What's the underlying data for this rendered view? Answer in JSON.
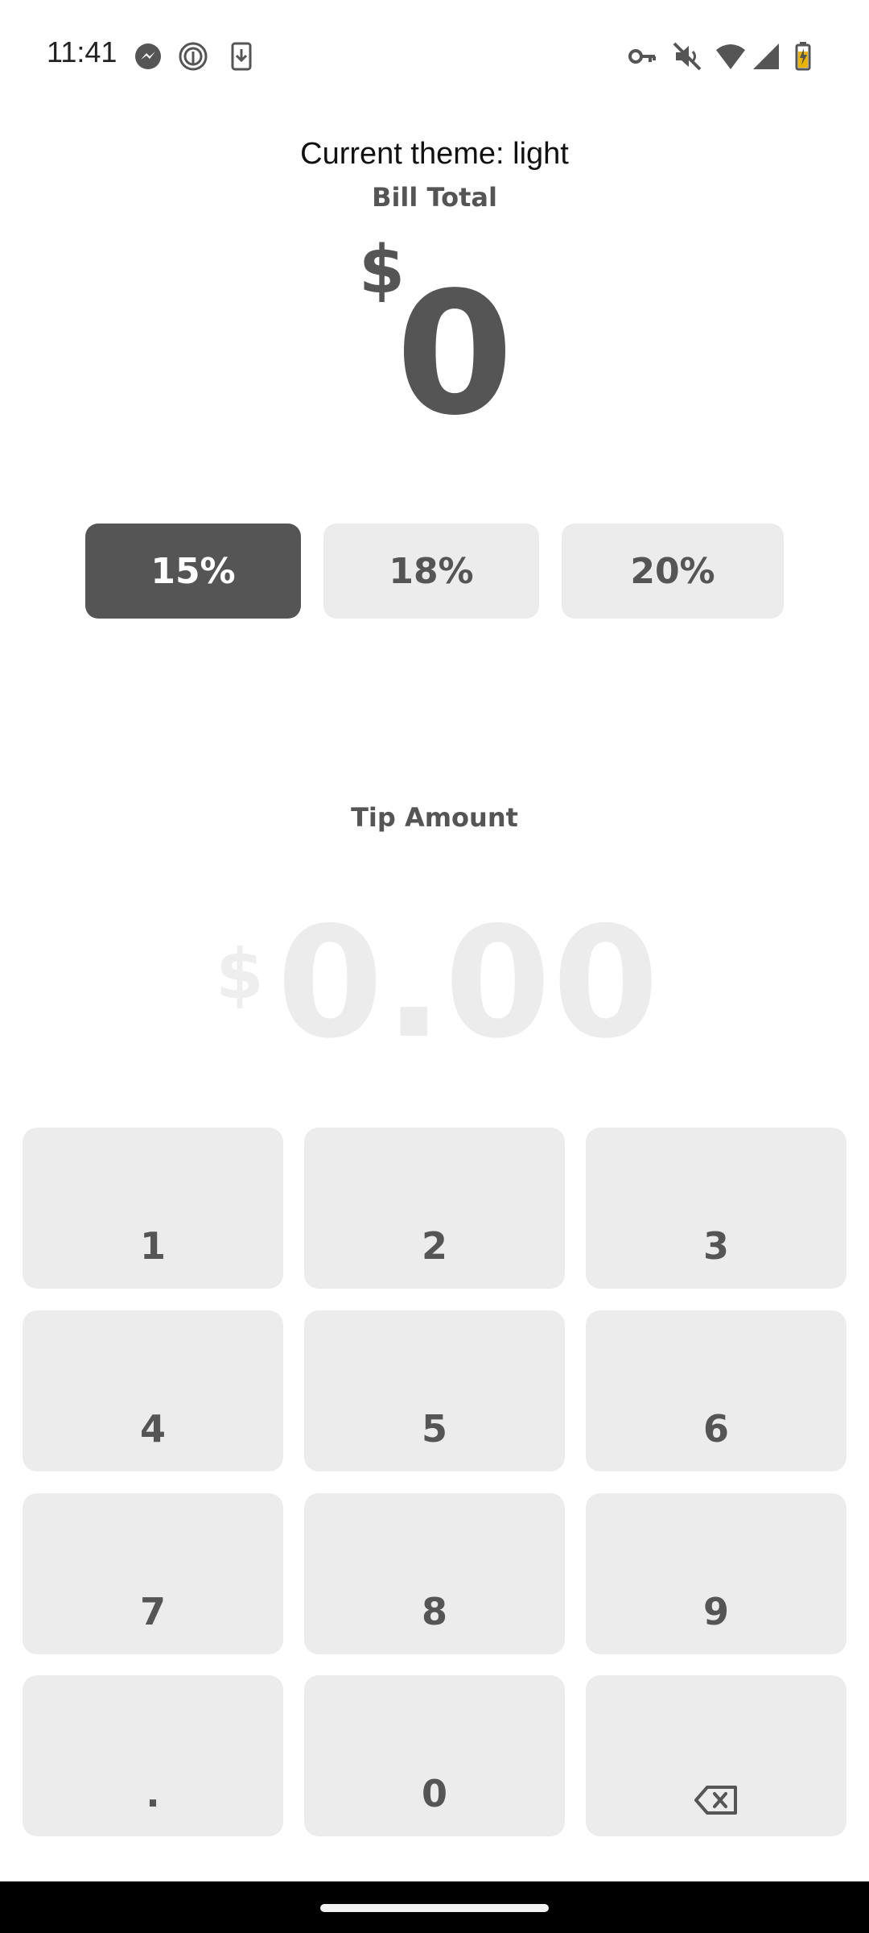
{
  "status_bar": {
    "time": "11:41",
    "left_icons": [
      "messenger-icon",
      "fingerprint-icon",
      "download-icon"
    ],
    "right_icons": [
      "vpn-key-icon",
      "mute-icon",
      "wifi-icon",
      "signal-icon",
      "battery-charging-icon"
    ]
  },
  "theme_label": "Current theme: light",
  "bill": {
    "label": "Bill Total",
    "currency": "$",
    "value": "0"
  },
  "tip_options": [
    {
      "label": "15%",
      "selected": true
    },
    {
      "label": "18%",
      "selected": false
    },
    {
      "label": "20%",
      "selected": false
    }
  ],
  "tip": {
    "label": "Tip Amount",
    "currency": "$",
    "value": "0.00"
  },
  "keypad": {
    "keys": [
      "1",
      "2",
      "3",
      "4",
      "5",
      "6",
      "7",
      "8",
      "9",
      ".",
      "0"
    ],
    "backspace_icon": "backspace-icon"
  },
  "colors": {
    "primary": "#555555",
    "button_bg": "#ececec",
    "placeholder": "#ececec"
  }
}
